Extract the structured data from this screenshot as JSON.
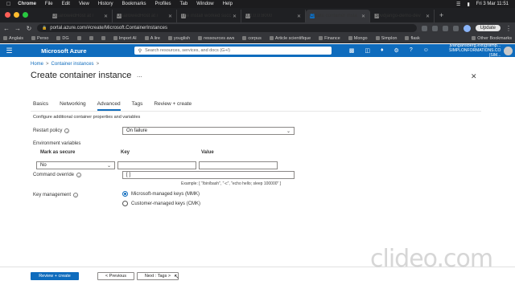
{
  "menubar": {
    "app": "Chrome",
    "items": [
      "File",
      "Edit",
      "View",
      "History",
      "Bookmarks",
      "Profiles",
      "Tab",
      "Window",
      "Help"
    ],
    "datetime": "Fri 3 Mar  11:51"
  },
  "tabs": [
    {
      "label": "DisallowedHost at /"
    },
    {
      "label": "DisallowedHost at /"
    },
    {
      "label": "The install worked succ"
    },
    {
      "label": "0.0.0.0:8000"
    },
    {
      "label": "Create container insta"
    },
    {
      "label": "j3ovdjango-demo-dev"
    }
  ],
  "address": {
    "url": "portal.azure.com/#create/Microsoft.ContainerInstances",
    "update_label": "Update"
  },
  "bookmarks": [
    "Anglais",
    "Perso",
    "DG",
    "",
    "",
    "",
    "Import AI",
    "A lire",
    "youglish",
    "ressources aws",
    "corpus",
    "Article scientifique",
    "Finance",
    "Mongo",
    "Simplon",
    "flask"
  ],
  "bookmarks_other": "Other Bookmarks",
  "azure": {
    "brand": "Microsoft Azure",
    "search_placeholder": "Search resources, services, and docs (G+/)",
    "user_name": "jvangansberg.ext@simp...",
    "user_org": "SIMPLONFORMATIONS.CO (SIM..."
  },
  "breadcrumb": {
    "home": "Home",
    "sep1": ">",
    "parent": "Container instances",
    "sep2": ">"
  },
  "page": {
    "title": "Create container instance",
    "more": "...",
    "close": "✕"
  },
  "wizard_tabs": [
    "Basics",
    "Networking",
    "Advanced",
    "Tags",
    "Review + create"
  ],
  "description": "Configure additional container properties and variables",
  "restart_policy": {
    "label": "Restart policy",
    "value": "On failure"
  },
  "env": {
    "label": "Environment variables",
    "col_secure": "Mark as secure",
    "col_key": "Key",
    "col_value": "Value",
    "secure_value": "No"
  },
  "command_override": {
    "label": "Command override",
    "value": "[ ]",
    "example": "Example: [ \"/bin/bash\", \"-c\", \"echo hello; sleep 100000\" ]"
  },
  "key_management": {
    "label": "Key management",
    "option_mmk": "Microsoft-managed keys (MMK)",
    "option_cmk": "Customer-managed keys (CMK)",
    "selected": "mmk"
  },
  "footer": {
    "review_create": "Review + create",
    "previous": "< Previous",
    "next": "Next : Tags >"
  },
  "watermark": "clideo.com",
  "colors": {
    "azure_blue": "#0f6cbd",
    "chrome_dark": "#35363a"
  }
}
